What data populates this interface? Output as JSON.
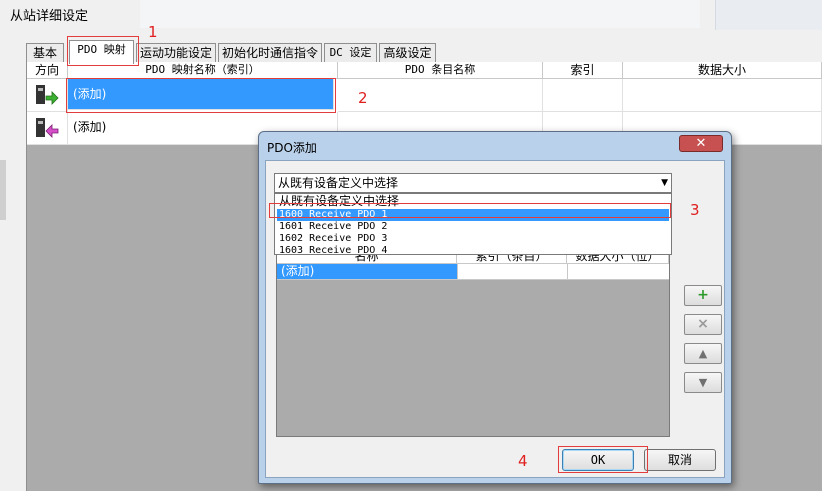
{
  "window": {
    "title": "从站详细设定"
  },
  "tabs": [
    {
      "label": "基本"
    },
    {
      "label": "PDO 映射"
    },
    {
      "label": "运动功能设定"
    },
    {
      "label": "初始化时通信指令"
    },
    {
      "label": "DC 设定"
    },
    {
      "label": "高级设定"
    }
  ],
  "mapping_table": {
    "columns": [
      "方向",
      "PDO 映射名称（索引）",
      "PDO 条目名称",
      "索引",
      "数据大小"
    ],
    "rows": [
      {
        "direction_icon": "output-arrow-icon",
        "name": "(添加)",
        "selected": true
      },
      {
        "direction_icon": "input-arrow-icon",
        "name": "(添加)",
        "selected": false
      }
    ]
  },
  "dialog": {
    "title": "PDO添加",
    "close_label": "✕",
    "select": {
      "value": "从既有设备定义中选择",
      "options": [
        "从既有设备定义中选择",
        "1600 Receive PDO 1",
        "1601 Receive PDO 2",
        "1602 Receive PDO 3",
        "1603 Receive PDO 4"
      ],
      "highlighted_index": 1
    },
    "entry_table": {
      "columns": [
        "名称",
        "索引（条目）",
        "数据大小（位）"
      ],
      "rows": [
        {
          "name": "(添加)"
        }
      ]
    },
    "side_buttons": [
      {
        "icon": "add-icon",
        "glyph": "+"
      },
      {
        "icon": "delete-icon",
        "glyph": "×"
      },
      {
        "icon": "move-up-icon",
        "glyph": "▲"
      },
      {
        "icon": "move-down-icon",
        "glyph": "▼"
      }
    ],
    "ok_label": "OK",
    "cancel_label": "取消"
  },
  "annotations": {
    "step1": "1",
    "step2": "2",
    "step3": "3",
    "step4": "4",
    "color": "#e02020"
  }
}
